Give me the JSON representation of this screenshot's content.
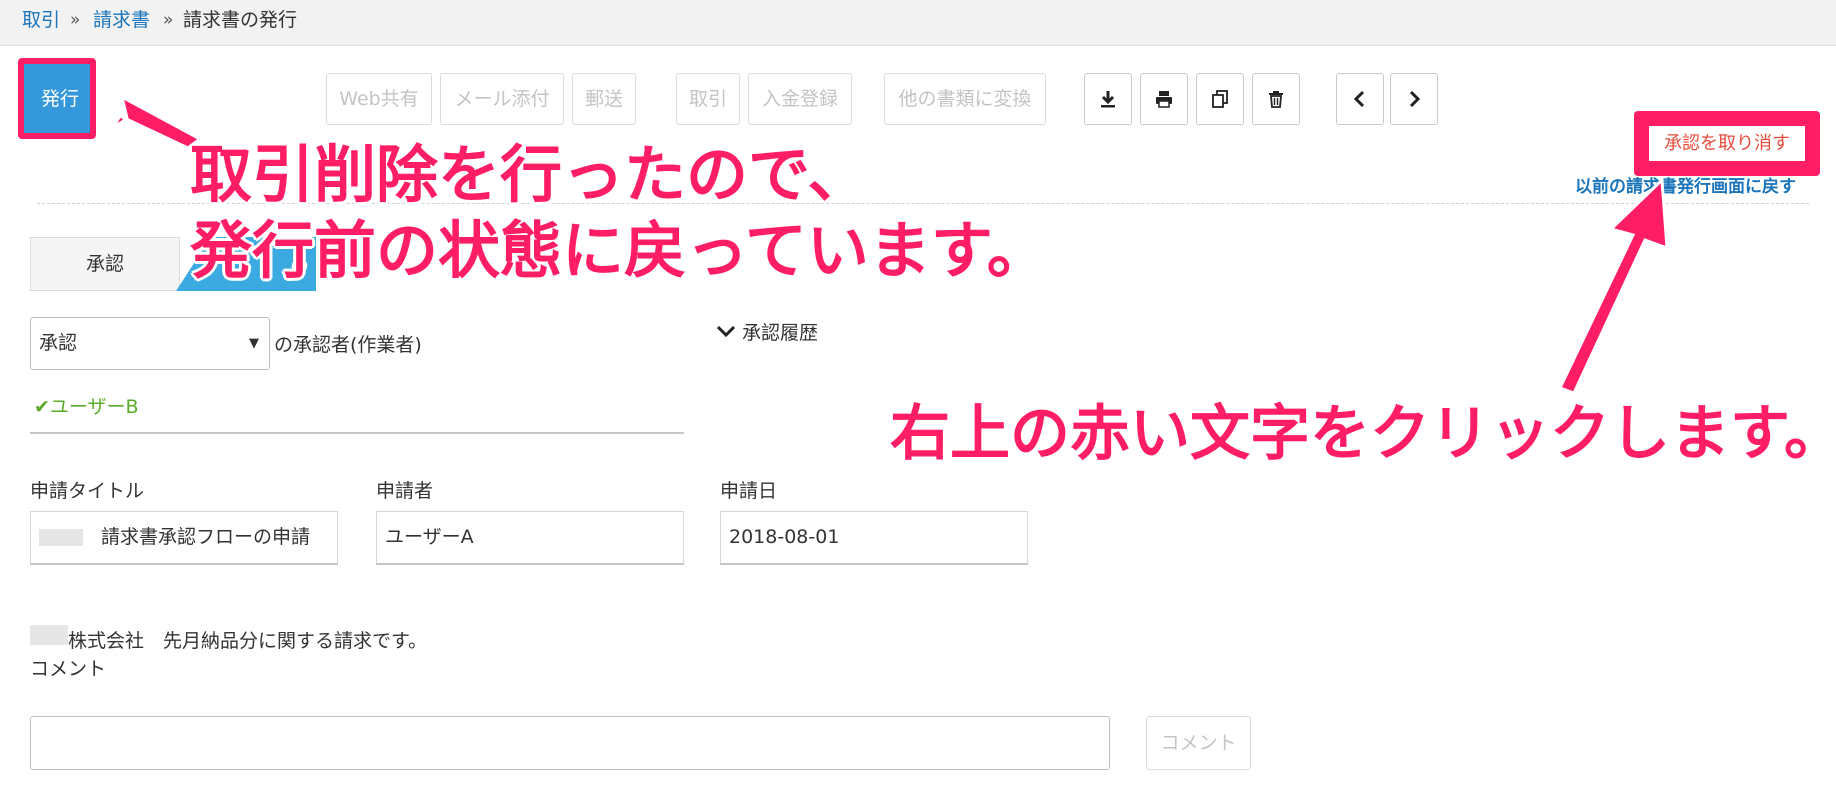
{
  "breadcrumb": {
    "item1": "取引",
    "sep": "»",
    "item2": "請求書",
    "current": "請求書の発行"
  },
  "toolbar": {
    "issue": "発行",
    "web_share": "Web共有",
    "mail_attach": "メール添付",
    "postal": "郵送",
    "deal": "取引",
    "payment": "入金登録",
    "convert": "他の書類に変換",
    "icons": [
      "download-icon",
      "print-icon",
      "copy-icon",
      "trash-icon",
      "chevron-left-icon",
      "chevron-right-icon"
    ]
  },
  "cancel_approval": "承認を取り消す",
  "back_link": "以前の請求書発行画面に戻す",
  "approval": {
    "step": "承認",
    "step_fragment": "の",
    "select_value": "承認",
    "approver_label": "の承認者(作業者)",
    "history": "承認履歴",
    "user": "ユーザーB"
  },
  "application": {
    "title_label": "申請タイトル",
    "title_value": "請求書承認フローの申請",
    "applicant_label": "申請者",
    "applicant_value": "ユーザーA",
    "date_label": "申請日",
    "date_value": "2018-08-01"
  },
  "message": "株式会社　先月納品分に関する請求です。",
  "comment": {
    "label": "コメント",
    "button": "コメント"
  },
  "annotations": {
    "note1_line1": "取引削除を行ったので、",
    "note1_line2": "発行前の状態に戻っています。",
    "note2": "右上の赤い文字をクリックします。"
  },
  "colors": {
    "link": "#1b75bb",
    "primary": "#3498db",
    "annotation": "#ff1e65",
    "cancel_text": "#e84c3d",
    "user_ok": "#5aaa2c"
  }
}
